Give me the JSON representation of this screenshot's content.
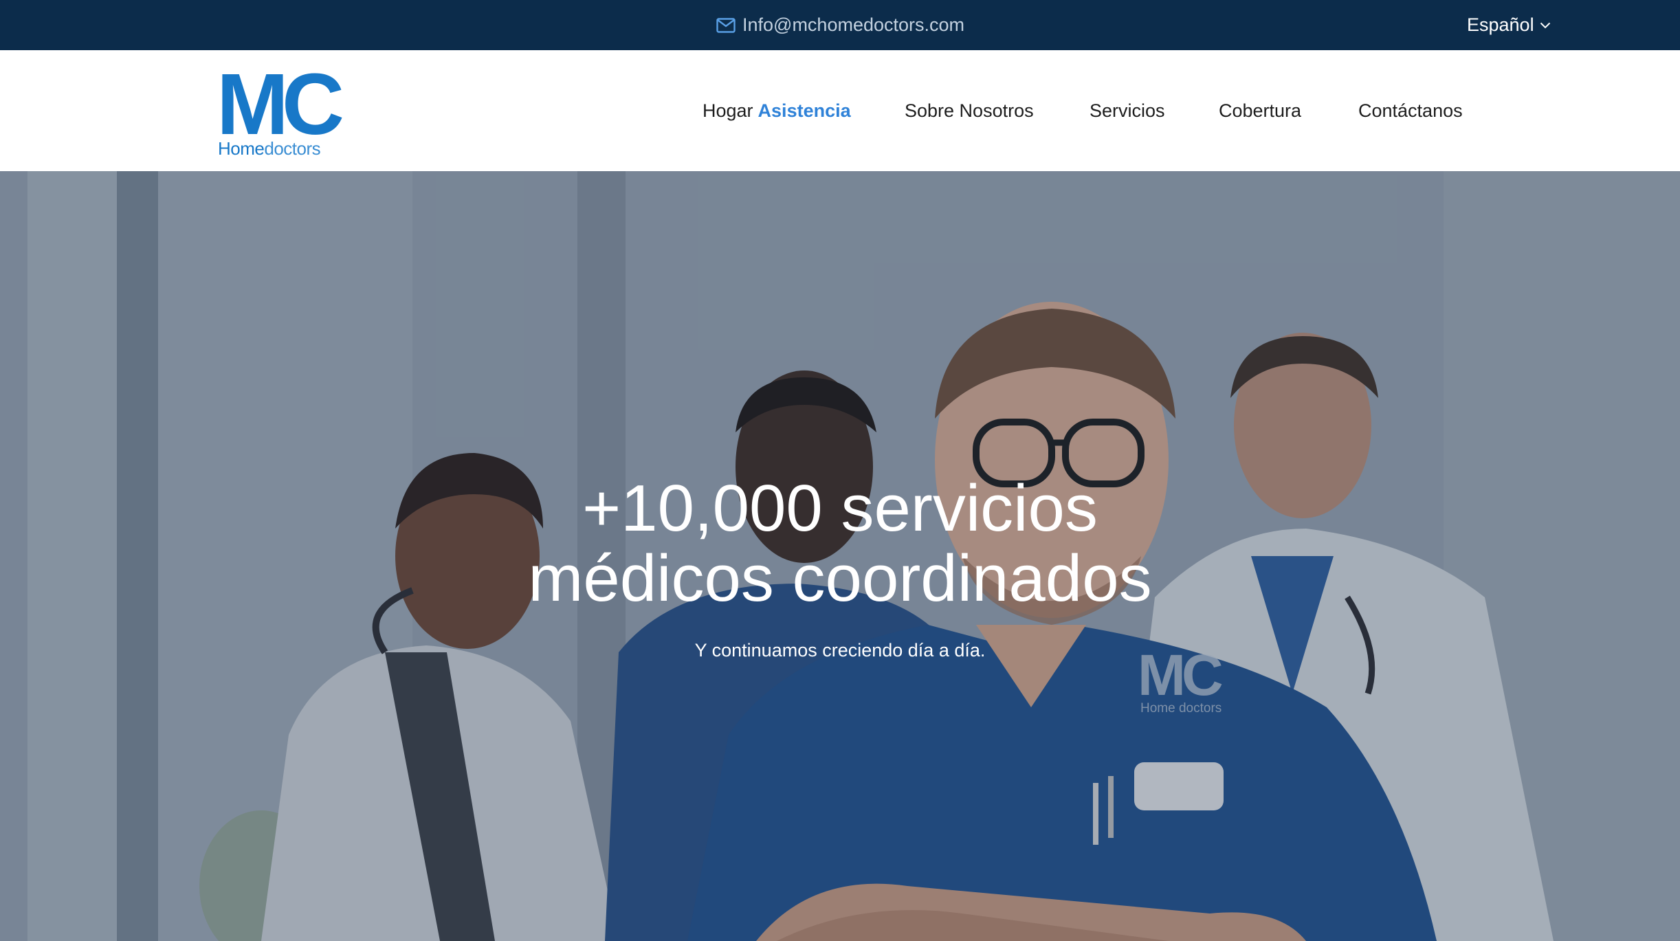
{
  "topbar": {
    "email": "Info@mchomedoctors.com",
    "email_icon": "mail-icon",
    "language": "Español",
    "language_icon": "chevron-down-icon"
  },
  "logo": {
    "mc": "MC",
    "home": "Home",
    "doctors": "doctors"
  },
  "nav": {
    "items": [
      {
        "label": "Hogar",
        "accent": "Asistencia"
      },
      {
        "label": "Sobre Nosotros"
      },
      {
        "label": "Servicios"
      },
      {
        "label": "Cobertura"
      },
      {
        "label": "Contáctanos"
      }
    ]
  },
  "hero": {
    "title_line1": "+10,000 servicios",
    "title_line2": "médicos coordinados",
    "subtitle": "Y continuamos creciendo día a día.",
    "scrub_logo_mc": "MC",
    "scrub_logo_sub": "Home doctors"
  },
  "colors": {
    "topbar_bg": "#0c2c4b",
    "brand_blue": "#1878c8",
    "nav_accent": "#2f82d8",
    "nav_text": "#1d1d1d"
  }
}
